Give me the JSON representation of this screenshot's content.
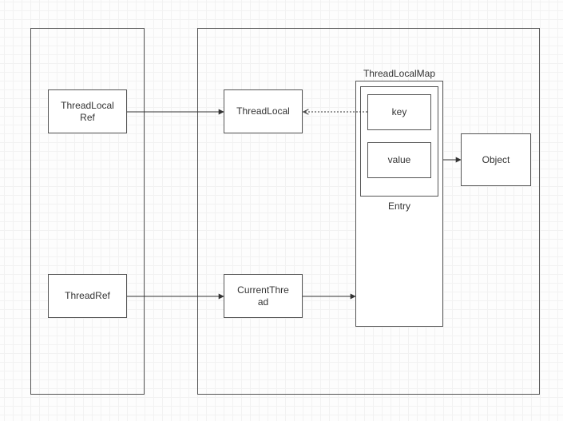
{
  "left_container": {
    "threadlocal_ref": "ThreadLocal\nRef",
    "thread_ref": "ThreadRef"
  },
  "right_container": {
    "threadlocal": "ThreadLocal",
    "current_thread": "CurrentThre\nad",
    "map_label": "ThreadLocalMap",
    "entry_label": "Entry",
    "key": "key",
    "value": "value",
    "object": "Object"
  },
  "chart_data": {
    "type": "diagram",
    "nodes": [
      {
        "id": "threadlocal_ref",
        "label": "ThreadLocalRef",
        "container": "left"
      },
      {
        "id": "thread_ref",
        "label": "ThreadRef",
        "container": "left"
      },
      {
        "id": "threadlocal",
        "label": "ThreadLocal",
        "container": "right"
      },
      {
        "id": "current_thread",
        "label": "CurrentThread",
        "container": "right"
      },
      {
        "id": "threadlocal_map",
        "label": "ThreadLocalMap",
        "container": "right",
        "type": "container"
      },
      {
        "id": "entry",
        "label": "Entry",
        "container": "threadlocal_map",
        "type": "container"
      },
      {
        "id": "key",
        "label": "key",
        "container": "entry"
      },
      {
        "id": "value",
        "label": "value",
        "container": "entry"
      },
      {
        "id": "object",
        "label": "Object",
        "container": "right"
      }
    ],
    "edges": [
      {
        "from": "threadlocal_ref",
        "to": "threadlocal",
        "style": "solid"
      },
      {
        "from": "thread_ref",
        "to": "current_thread",
        "style": "solid"
      },
      {
        "from": "current_thread",
        "to": "threadlocal_map",
        "style": "solid"
      },
      {
        "from": "key",
        "to": "threadlocal",
        "style": "dotted"
      },
      {
        "from": "value",
        "to": "object",
        "style": "solid"
      }
    ]
  }
}
